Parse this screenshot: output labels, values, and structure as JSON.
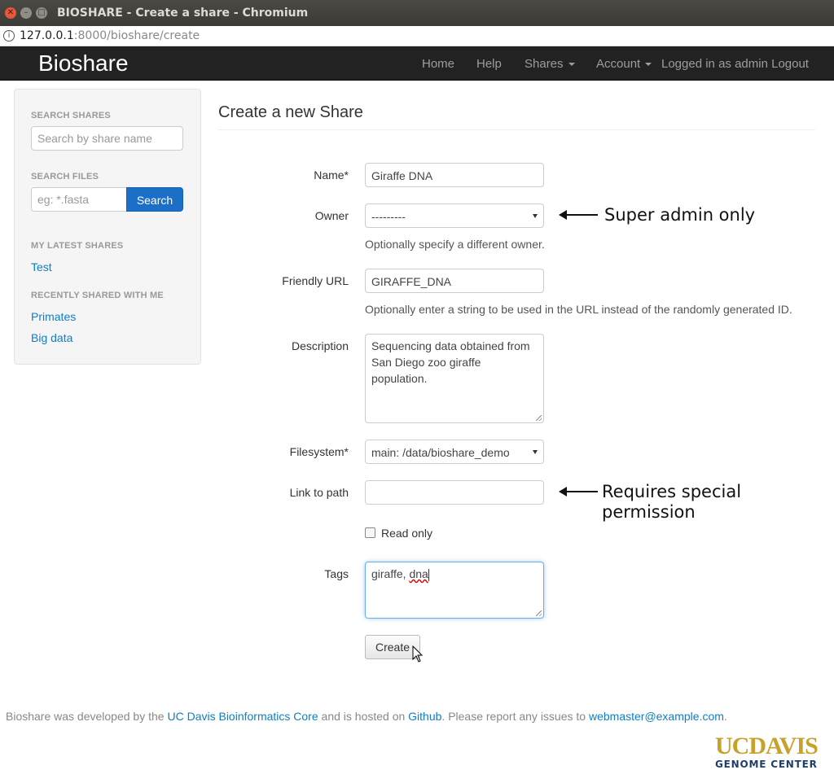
{
  "window": {
    "title": "BIOSHARE - Create a share - Chromium"
  },
  "address": {
    "host": "127.0.0.1",
    "rest": ":8000/bioshare/create"
  },
  "navbar": {
    "brand": "Bioshare",
    "home": "Home",
    "help": "Help",
    "shares": "Shares",
    "account": "Account",
    "logged_in": "Logged in as admin Logout"
  },
  "sidebar": {
    "search_shares_heading": "SEARCH SHARES",
    "search_shares_placeholder": "Search by share name",
    "search_files_heading": "SEARCH FILES",
    "search_files_placeholder": "eg: *.fasta",
    "search_button": "Search",
    "latest_heading": "MY LATEST SHARES",
    "latest": [
      "Test"
    ],
    "recent_heading": "RECENTLY SHARED WITH ME",
    "recent": [
      "Primates",
      "Big data"
    ]
  },
  "form": {
    "title": "Create a new Share",
    "name_label": "Name*",
    "name_value": "Giraffe DNA",
    "owner_label": "Owner",
    "owner_value": "---------",
    "owner_help": "Optionally specify a different owner.",
    "url_label": "Friendly URL",
    "url_value": "GIRAFFE_DNA",
    "url_help": "Optionally enter a string to be used in the URL instead of the randomly generated ID.",
    "desc_label": "Description",
    "desc_value": "Sequencing data obtained from San Diego zoo giraffe population.",
    "fs_label": "Filesystem*",
    "fs_value": "main: /data/bioshare_demo",
    "link_label": "Link to path",
    "link_value": "",
    "readonly_label": "Read only",
    "tags_label": "Tags",
    "tags_value_a": "giraffe, ",
    "tags_value_b": "dna",
    "create_button": "Create"
  },
  "annotations": {
    "owner_note": "Super admin only",
    "link_note_1": "Requires special",
    "link_note_2": "permission"
  },
  "footer": {
    "t1": "Bioshare was developed by the ",
    "l1": "UC Davis Bioinformatics Core",
    "t2": " and is hosted on ",
    "l2": "Github",
    "t3": ". Please report any issues to ",
    "l3": "webmaster@example.com",
    "t4": "."
  },
  "logo": {
    "line1": "UCDAVIS",
    "line2": "GENOME CENTER"
  }
}
